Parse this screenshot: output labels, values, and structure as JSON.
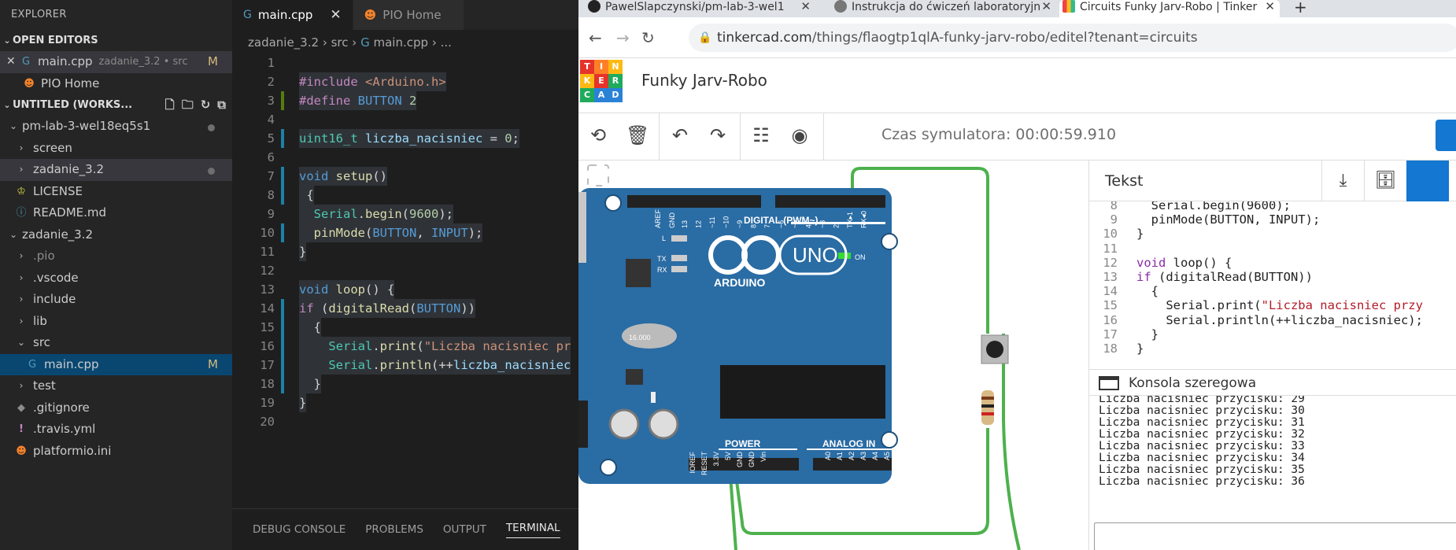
{
  "vscode": {
    "explorer_title": "EXPLORER",
    "open_editors_title": "OPEN EDITORS",
    "open_editors": [
      {
        "name": "main.cpp",
        "hint": "zadanie_3.2 • src",
        "badge": "M"
      },
      {
        "name": "PIO Home"
      }
    ],
    "workspace_title": "UNTITLED (WORKS...",
    "tree": [
      {
        "label": "pm-lab-3-wel18eq5s1"
      },
      {
        "label": "screen"
      },
      {
        "label": "zadanie_3.2"
      },
      {
        "label": "LICENSE"
      },
      {
        "label": "README.md"
      },
      {
        "label": "zadanie_3.2"
      },
      {
        "label": ".pio"
      },
      {
        "label": ".vscode"
      },
      {
        "label": "include"
      },
      {
        "label": "lib"
      },
      {
        "label": "src"
      },
      {
        "label": "main.cpp",
        "badge": "M"
      },
      {
        "label": "test"
      },
      {
        "label": ".gitignore"
      },
      {
        "label": ".travis.yml"
      },
      {
        "label": "platformio.ini"
      }
    ],
    "tabs": [
      {
        "label": "main.cpp"
      },
      {
        "label": "PIO Home"
      }
    ],
    "breadcrumb": {
      "p1": "zadanie_3.2",
      "p2": "src",
      "p3": "main.cpp",
      "p4": "..."
    },
    "line_numbers": [
      "1",
      "2",
      "3",
      "4",
      "5",
      "6",
      "7",
      "8",
      "9",
      "10",
      "11",
      "12",
      "13",
      "14",
      "15",
      "16",
      "17",
      "18",
      "19",
      "20"
    ],
    "code": {
      "l2a": "#include ",
      "l2b": "<Arduino.h>",
      "l3a": "#define ",
      "l3b": "BUTTON",
      "l3c": " 2",
      "l5a": "uint16_t",
      "l5b": " liczba_nacisniec",
      "l5c": " = ",
      "l5d": "0",
      "l5e": ";",
      "l7a": "void",
      "l7b": " setup",
      "l7c": "()",
      "l8": " {",
      "l9a": "  Serial",
      "l9b": ".",
      "l9c": "begin",
      "l9d": "(",
      "l9e": "9600",
      "l9f": ");",
      "l10a": "  pinMode",
      "l10b": "(",
      "l10c": "BUTTON",
      "l10d": ", ",
      "l10e": "INPUT",
      "l10f": ");",
      "l11": "}",
      "l13a": "void",
      "l13b": " loop",
      "l13c": "() {",
      "l14a": "if",
      "l14b": " (",
      "l14c": "digitalRead",
      "l14d": "(",
      "l14e": "BUTTON",
      "l14f": "))",
      "l15": "  {",
      "l16a": "    Serial",
      "l16b": ".",
      "l16c": "print",
      "l16d": "(",
      "l16e": "\"Liczba nacisniec pr",
      "l17a": "    Serial",
      "l17b": ".",
      "l17c": "println",
      "l17d": "(++",
      "l17e": "liczba_nacisniec",
      "l18": "  }",
      "l19": "}"
    },
    "panel_tabs": [
      "DEBUG CONSOLE",
      "PROBLEMS",
      "OUTPUT",
      "TERMINAL"
    ]
  },
  "browser": {
    "tabs": [
      {
        "label": "PawelSlapczynski/pm-lab-3-wel1"
      },
      {
        "label": "Instrukcja do ćwiczeń laboratoryjn"
      },
      {
        "label": "Circuits Funky Jarv-Robo | Tinker"
      }
    ],
    "new_tab": "+",
    "url_host": "tinkercad.com",
    "url_path": "/things/flaogtp1qlA-funky-jarv-robo/editel?tenant=circuits",
    "tinkercad": {
      "logo_letters": [
        "T",
        "I",
        "N",
        "K",
        "E",
        "R",
        "C",
        "A",
        "D"
      ],
      "project_name": "Funky Jarv-Robo",
      "sim_time": "Czas symulatora: 00:00:59.910",
      "text_panel_title": "Tekst",
      "serial_title": "Konsola szeregowa",
      "code_lines": [
        {
          "n": "8",
          "t": "  Serial.begin(9600);"
        },
        {
          "n": "9",
          "t": "  pinMode(BUTTON, INPUT);"
        },
        {
          "n": "10",
          "t": "}"
        },
        {
          "n": "11",
          "t": ""
        },
        {
          "n": "12",
          "kw": "void",
          "t": " loop() {"
        },
        {
          "n": "13",
          "kw": "if",
          "t": " (digitalRead(BUTTON))"
        },
        {
          "n": "14",
          "t": "  {"
        },
        {
          "n": "15",
          "pre": "    Serial.print(",
          "str": "\"Liczba nacisniec przy"
        },
        {
          "n": "16",
          "t": "    Serial.println(++liczba_nacisniec);"
        },
        {
          "n": "17",
          "t": "  }"
        },
        {
          "n": "18",
          "t": "}"
        }
      ],
      "serial_lines": [
        "Liczba nacisniec przycisku: 29",
        "Liczba nacisniec przycisku: 30",
        "Liczba nacisniec przycisku: 31",
        "Liczba nacisniec przycisku: 32",
        "Liczba nacisniec przycisku: 33",
        "Liczba nacisniec przycisku: 34",
        "Liczba nacisniec przycisku: 35",
        "Liczba nacisniec przycisku: 36"
      ]
    },
    "board": {
      "brand": "ARDUINO",
      "model": "UNO",
      "digital_label": "DIGITAL (PWM~)",
      "power_label": "POWER",
      "analog_label": "ANALOG IN",
      "on_label": "ON",
      "l_label": "L",
      "tx_label": "TX",
      "rx_label": "RX",
      "aref": "AREF",
      "gnd": "GND",
      "digital_pins": [
        "13",
        "12",
        "~11",
        "~10",
        "~9",
        "8",
        "7",
        "~6",
        "~5",
        "4",
        "~3",
        "2",
        "TX▸1",
        "RX◂0"
      ],
      "power_pins": [
        "IOREF",
        "RESET",
        "3.3V",
        "5V",
        "GND",
        "GND",
        "Vin"
      ],
      "analog_pins": [
        "A0",
        "A1",
        "A2",
        "A3",
        "A4",
        "A5"
      ],
      "crystal": "16.000"
    }
  }
}
